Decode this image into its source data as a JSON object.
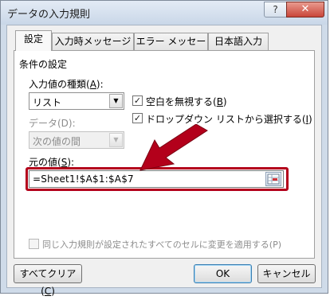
{
  "window": {
    "title": "データの入力規則",
    "help_glyph": "?",
    "close_glyph": "✕"
  },
  "tabs": [
    {
      "label": "設定",
      "active": true
    },
    {
      "label": "入力時メッセージ",
      "active": false
    },
    {
      "label": "エラー メッセージ",
      "active": false
    },
    {
      "label": "日本語入力",
      "active": false
    }
  ],
  "settings": {
    "group_title": "条件の設定",
    "allow_label": "入力値の種類(",
    "allow_key": "A",
    "label_close": "):",
    "allow_value": "リスト",
    "data_label": "データ(D):",
    "data_value": "次の値の間",
    "ignore_blank_label": "空白を無視する(",
    "ignore_blank_key": "B",
    "ignore_blank_checked": true,
    "dropdown_label": "ドロップダウン リストから選択する(",
    "dropdown_key": "I",
    "dropdown_checked": true,
    "source_label": "元の値(",
    "source_key": "S",
    "source_value": "=Sheet1!$A$1:$A$7",
    "apply_all_label": "同じ入力規則が設定されたすべてのセルに変更を適用する(P)",
    "apply_all_checked": false
  },
  "buttons": {
    "clear_all": "すべてクリア(",
    "clear_all_key": "C",
    "close_paren": ")",
    "ok": "OK",
    "cancel": "キャンセル"
  },
  "annotation": {
    "color": "#b3001b"
  },
  "colors": {
    "accent": "#b3001b",
    "frame": "#cfdbe9",
    "close_button": "#c9463a"
  }
}
